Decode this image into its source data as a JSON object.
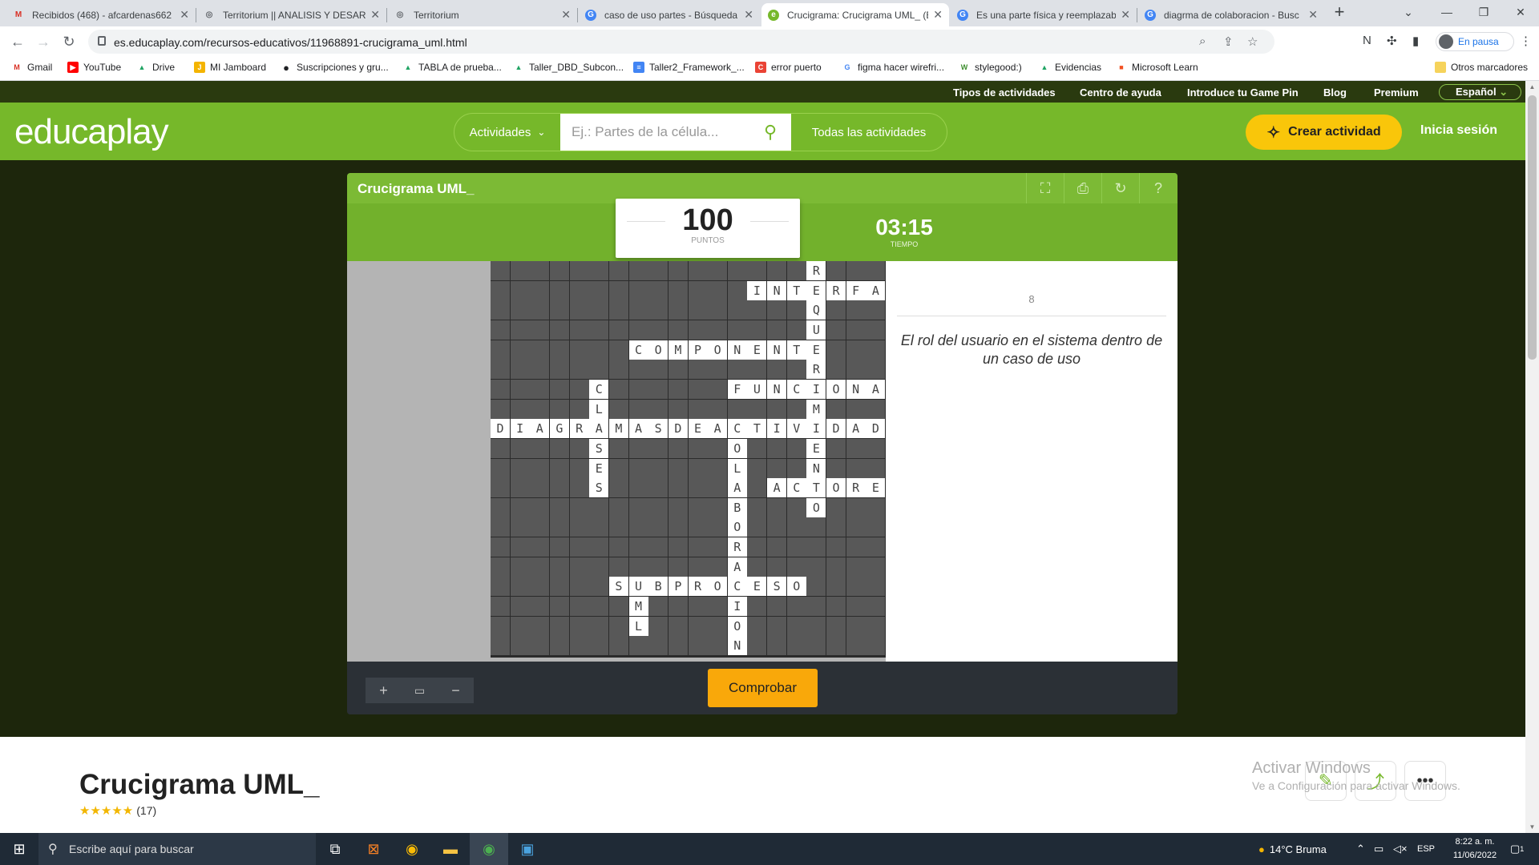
{
  "browser": {
    "tabs": [
      {
        "title": "Recibidos (468) - afcardenas662",
        "icon_color": "#d93025",
        "icon": "M"
      },
      {
        "title": "Territorium || ANALISIS Y DESAR",
        "icon_color": "#5f6368",
        "icon": "◎"
      },
      {
        "title": "Territorium",
        "icon_color": "#5f6368",
        "icon": "◎"
      },
      {
        "title": "caso de uso partes - Búsqueda c",
        "icon_color": "#4285f4",
        "icon": "G"
      },
      {
        "title": "Crucigrama: Crucigrama UML_ (E",
        "icon_color": "#76b82a",
        "icon": "e"
      },
      {
        "title": "Es una parte física y reemplazab",
        "icon_color": "#4285f4",
        "icon": "G"
      },
      {
        "title": "diagrma de colaboracion - Busc",
        "icon_color": "#4285f4",
        "icon": "G"
      }
    ],
    "url": "es.educaplay.com/recursos-educativos/11968891-crucigrama_uml.html",
    "profile_label": "En pausa",
    "bookmarks": [
      {
        "label": "Gmail",
        "color": "#d93025",
        "icon": "M"
      },
      {
        "label": "YouTube",
        "color": "#ff0000",
        "icon": "▶"
      },
      {
        "label": "Drive",
        "color": "#1fa463",
        "icon": "▲"
      },
      {
        "label": "MI Jamboard",
        "color": "#f4b400",
        "icon": "J"
      },
      {
        "label": "Suscripciones y gru...",
        "color": "#202124",
        "icon": "●"
      },
      {
        "label": "TABLA de prueba...",
        "color": "#1fa463",
        "icon": "▲"
      },
      {
        "label": "Taller_DBD_Subcon...",
        "color": "#1fa463",
        "icon": "▲"
      },
      {
        "label": "Taller2_Framework_...",
        "color": "#4285f4",
        "icon": "≡"
      },
      {
        "label": "error puerto",
        "color": "#ea4335",
        "icon": "C"
      },
      {
        "label": "figma hacer wirefri...",
        "color": "#4285f4",
        "icon": "G"
      },
      {
        "label": "stylegood:)",
        "color": "#3e8e2f",
        "icon": "W"
      },
      {
        "label": "Evidencias",
        "color": "#1fa463",
        "icon": "▲"
      },
      {
        "label": "Microsoft Learn",
        "color": "#f25022",
        "icon": "■"
      }
    ],
    "other_bookmarks": "Otros marcadores"
  },
  "site": {
    "top_links": [
      "Tipos de actividades",
      "Centro de ayuda",
      "Introduce tu Game Pin",
      "Blog",
      "Premium"
    ],
    "language": "Español",
    "logo": "educaplay",
    "activities_label": "Actividades",
    "search_placeholder": "Ej.: Partes de la célula...",
    "all_activities": "Todas las actividades",
    "create_label": "Crear actividad",
    "login_label": "Inicia sesión"
  },
  "game": {
    "title": "Crucigrama UML_",
    "points": "100",
    "points_label": "PUNTOS",
    "time": "03:15",
    "time_label": "TIEMPO",
    "clue_number": "8",
    "clue_text": "El rol del usuario en el sistema dentro de un caso de uso",
    "check_label": "Comprobar",
    "zoom_in": "+",
    "zoom_fit": "▭",
    "zoom_out": "−"
  },
  "crossword": {
    "rows": 20,
    "cols": 21,
    "words": [
      {
        "text": "REQUERIMIENTO",
        "row": 0,
        "col": 16,
        "dir": "down"
      },
      {
        "text": "INTERFA",
        "row": 1,
        "col": 13,
        "dir": "across"
      },
      {
        "text": "COMPONENTE",
        "row": 4,
        "col": 7,
        "dir": "across"
      },
      {
        "text": "CLASES",
        "row": 6,
        "col": 5,
        "dir": "down"
      },
      {
        "text": "FUNCIONA",
        "row": 6,
        "col": 12,
        "dir": "across"
      },
      {
        "text": "DIAGRAMASDEACTIVIDAD",
        "row": 8,
        "col": 0,
        "dir": "across"
      },
      {
        "text": "COLABORACION",
        "row": 8,
        "col": 12,
        "dir": "down"
      },
      {
        "text": "ACTORES",
        "row": 11,
        "col": 14,
        "dir": "across"
      },
      {
        "text": "SUBPROCESO",
        "row": 16,
        "col": 6,
        "dir": "across"
      },
      {
        "text": "UML",
        "row": 16,
        "col": 7,
        "dir": "down"
      }
    ]
  },
  "page": {
    "title": "Crucigrama UML_",
    "stars": "★★★★★",
    "rating_count": "(17)",
    "activation_title": "Activar Windows",
    "activation_sub": "Ve a Configuración para activar Windows."
  },
  "taskbar": {
    "search_placeholder": "Escribe aquí para buscar",
    "weather": "14°C  Bruma",
    "lang": "ESP",
    "time": "8:22 a. m.",
    "date": "11/06/2022",
    "notif_count": "1"
  },
  "colors": {
    "brand_green": "#76b82a",
    "dark_bg": "#1d260c",
    "check_orange": "#f9a80a",
    "create_yellow": "#f9c60a"
  }
}
